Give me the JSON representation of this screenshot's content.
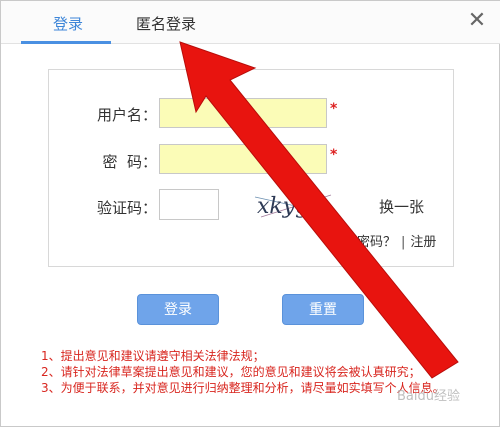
{
  "tabs": [
    {
      "label": "登录",
      "active": true
    },
    {
      "label": "匿名登录",
      "active": false
    }
  ],
  "close_label": "✕",
  "form": {
    "username_label": "用户名：",
    "password_label": "密  码：",
    "captcha_label": "验证码：",
    "username_value": "",
    "password_value": "",
    "captcha_value": "",
    "required_mark": "*",
    "captcha_text": "xkygm",
    "refresh_label": "换一张",
    "forgot_password": "忘记密码？",
    "register": "注册",
    "separator": "|"
  },
  "buttons": {
    "login": "登录",
    "reset": "重置"
  },
  "notes": [
    "1、提出意见和建议请遵守相关法律法规；",
    "2、请针对法律草案提出意见和建议，您的意见和建议将会被认真研究；",
    "3、为便于联系，并对意见进行归纳整理和分析，请尽量如实填写个人信息。"
  ],
  "watermark": "Baidu经验",
  "colors": {
    "accent": "#4a90e2",
    "field_bg": "#fbfcb7",
    "button_bg": "#6fa4ea",
    "note_text": "#d8261f",
    "arrow": "#e8140f"
  }
}
